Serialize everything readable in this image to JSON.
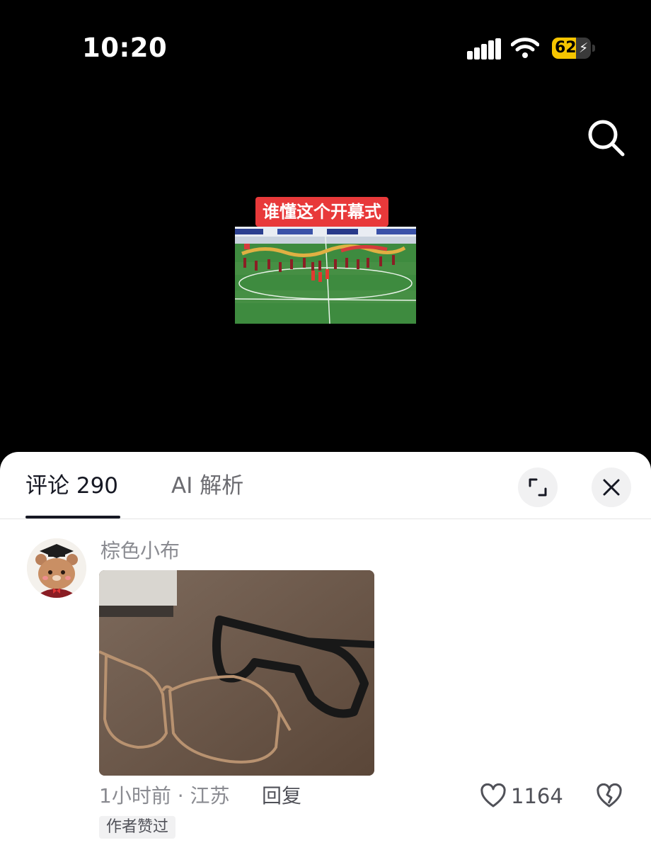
{
  "status_bar": {
    "time": "10:20",
    "battery": "62",
    "battery_level": 0.62
  },
  "colors": {
    "badge_red": "#e8393a",
    "battery_yellow": "#f6c500",
    "sheet_bg": "#ffffff"
  },
  "video": {
    "title": "谁懂这个开幕式"
  },
  "comments_panel": {
    "tabs": [
      {
        "label": "评论 290"
      },
      {
        "label": "AI 解析"
      }
    ],
    "comment": {
      "username": "棕色小布",
      "meta": "1小时前 · 江苏",
      "reply_label": "回复",
      "like_count": "1164",
      "author_liked_badge": "作者赞过"
    }
  },
  "icons": {
    "search": "search-icon",
    "expand": "expand-icon",
    "close": "close-icon",
    "like": "heart-icon",
    "dislike": "broken-heart-icon"
  }
}
